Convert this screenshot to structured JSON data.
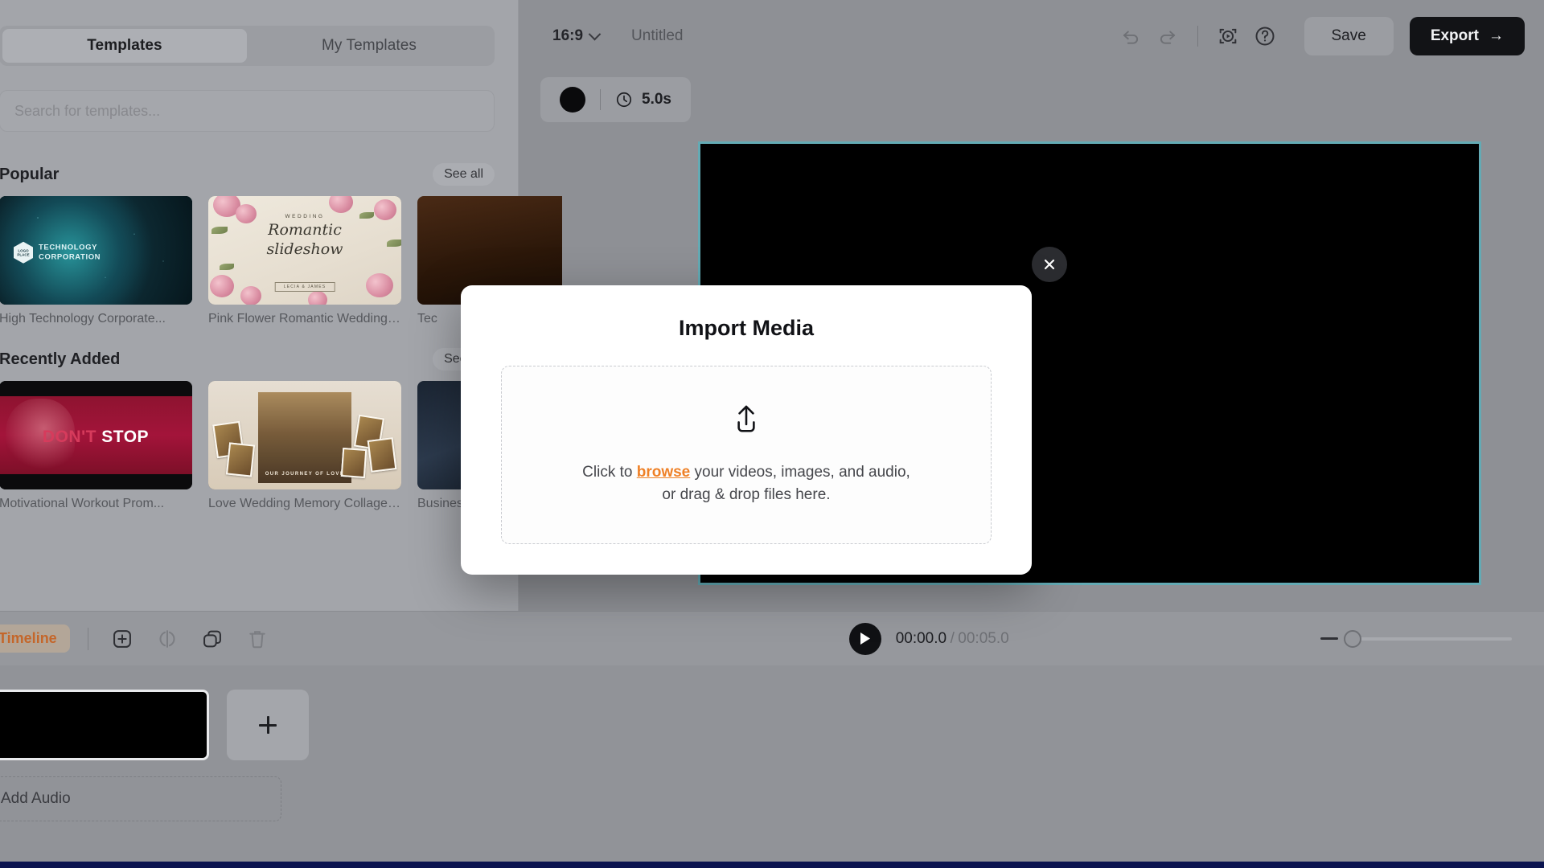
{
  "left_panel": {
    "tabs": [
      {
        "label": "Templates",
        "active": true
      },
      {
        "label": "My Templates",
        "active": false
      }
    ],
    "search": {
      "placeholder": "Search for templates...",
      "value": ""
    },
    "sections": [
      {
        "title": "Popular",
        "see_all": "See all",
        "items": [
          {
            "caption": "High Technology Corporate...",
            "art": "tech",
            "overlay_line1": "TECHNOLOGY",
            "overlay_line2": "CORPORATION",
            "logo_text": "LOGO PLACE"
          },
          {
            "caption": "Pink Flower Romantic Wedding ...",
            "art": "wedding",
            "kicker": "WEDDING",
            "script1": "Romantic",
            "script2": "slideshow",
            "badge": "LECIA & JAMES"
          },
          {
            "caption": "Tec",
            "art": "dark"
          }
        ]
      },
      {
        "title": "Recently Added",
        "see_all": "See all",
        "items": [
          {
            "caption": "Motivational Workout Prom...",
            "art": "workout",
            "word1": "DON'T",
            "word2": "STOP"
          },
          {
            "caption": "Love Wedding Memory Collage ...",
            "art": "collage",
            "badge": "OUR JOURNEY OF LOVE"
          },
          {
            "caption": "Business",
            "art": "business"
          }
        ]
      }
    ]
  },
  "topbar": {
    "aspect_ratio": "16:9",
    "document_title": "Untitled",
    "icons": [
      {
        "name": "undo-icon"
      },
      {
        "name": "redo-icon"
      },
      {
        "name": "preview-frame-icon"
      },
      {
        "name": "help-icon"
      }
    ],
    "save_label": "Save",
    "export_label": "Export",
    "export_arrow": "→"
  },
  "scene_chip": {
    "duration": "5.0s",
    "clock_icon": "clock-icon"
  },
  "toolbar": {
    "timeline_tab": "Timeline",
    "actions": [
      {
        "name": "add-element-icon",
        "enabled": true
      },
      {
        "name": "split-clip-icon",
        "enabled": false
      },
      {
        "name": "duplicate-icon",
        "enabled": true
      },
      {
        "name": "delete-icon",
        "enabled": true
      }
    ],
    "player": {
      "current_time": "00:00.0",
      "separator": "/",
      "total_time": "00:05.0"
    },
    "zoom": {
      "minus_label": "−",
      "value_percent": 0
    }
  },
  "timeline": {
    "add_scene_label": "+",
    "audio_zone_label": "Add Audio"
  },
  "modal": {
    "title": "Import Media",
    "upload_icon": "upload-icon",
    "line1_before": "Click to ",
    "line1_link": "browse",
    "line1_after": " your videos, images, and audio,",
    "line2": "or drag & drop files here.",
    "close_icon": "close-icon"
  },
  "colors": {
    "accent_orange": "#ef8127",
    "canvas_border": "#63aab4",
    "export_bg": "#121316",
    "timeline_tab_text": "#c4662a"
  }
}
